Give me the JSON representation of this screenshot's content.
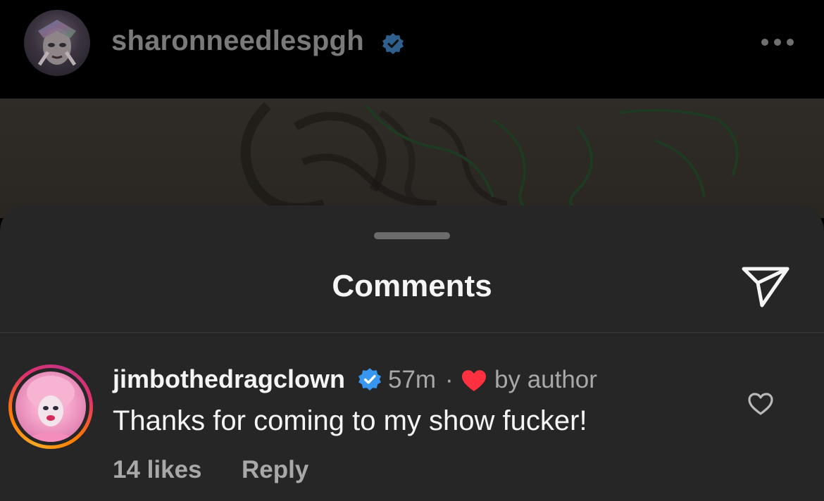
{
  "post": {
    "username": "sharonneedlespgh",
    "verified": true
  },
  "comments_sheet": {
    "title": "Comments",
    "items": [
      {
        "username": "jimbothedragclown",
        "verified": true,
        "time": "57m",
        "separator": "·",
        "author_badge": "by author",
        "text": "Thanks for coming to my show fucker!",
        "likes": "14 likes",
        "reply_label": "Reply"
      }
    ]
  },
  "icons": {
    "more": "more-horizontal-icon",
    "share": "paper-plane-icon",
    "verified": "verified-badge-icon",
    "author_like": "heart-filled-icon",
    "like": "heart-outline-icon"
  },
  "colors": {
    "sheet_bg": "#262626",
    "verified_blue": "#3797f0",
    "heart_red": "#ff3040",
    "secondary_text": "#a8a8a8"
  }
}
